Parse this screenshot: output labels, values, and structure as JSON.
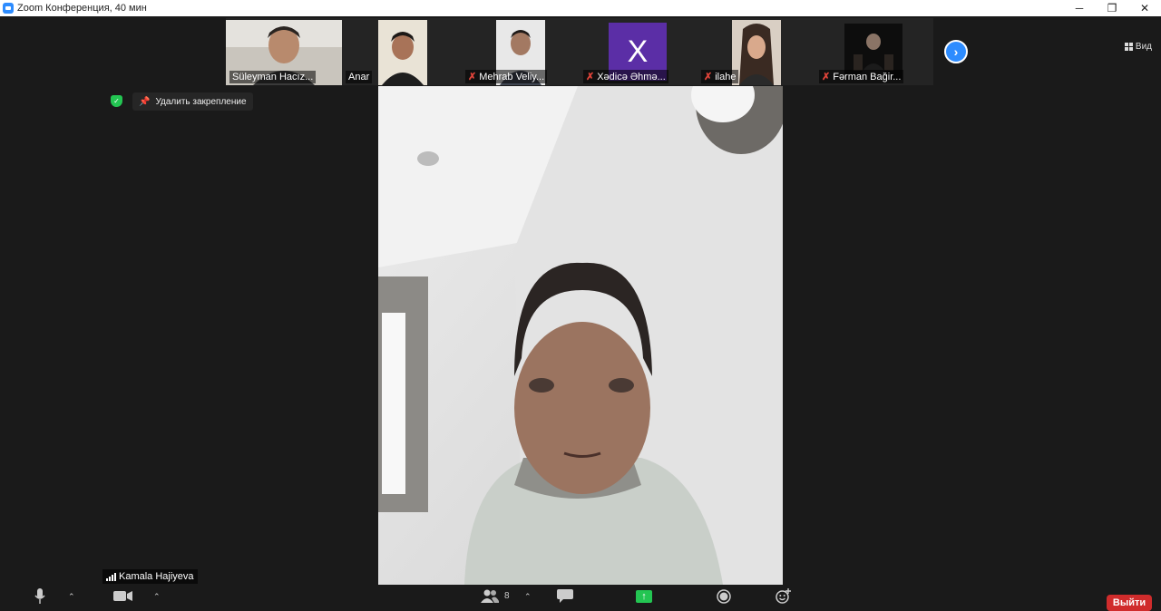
{
  "window": {
    "title": "Zoom Конференция, 40 мин",
    "controls": {
      "minimize": "─",
      "restore": "❐",
      "close": "✕"
    }
  },
  "view_button": {
    "icon": "grid-icon",
    "label": "Вид"
  },
  "participants": [
    {
      "name": "Süleyman Hacız...",
      "muted": false,
      "avatar": "video"
    },
    {
      "name": "Anar",
      "muted": false,
      "avatar": "video"
    },
    {
      "name": "Mehrab Veliy...",
      "muted": true,
      "avatar": "video"
    },
    {
      "name": "Xədicə Əhmə...",
      "muted": true,
      "avatar": "X"
    },
    {
      "name": "ilahe",
      "muted": true,
      "avatar": "video"
    },
    {
      "name": "Fərman Bağir...",
      "muted": true,
      "avatar": "video"
    }
  ],
  "pin": {
    "label": "Удалить закрепление"
  },
  "speaker": {
    "name": "Kamala Hajiyeva"
  },
  "toolbar": {
    "participants_count": "8",
    "leave_label": "Выйти"
  },
  "colors": {
    "accent": "#2d8cff",
    "mute": "#e0443a",
    "share": "#23c552",
    "leave": "#d02c2c",
    "initial_avatar": "#5b2ea6"
  }
}
